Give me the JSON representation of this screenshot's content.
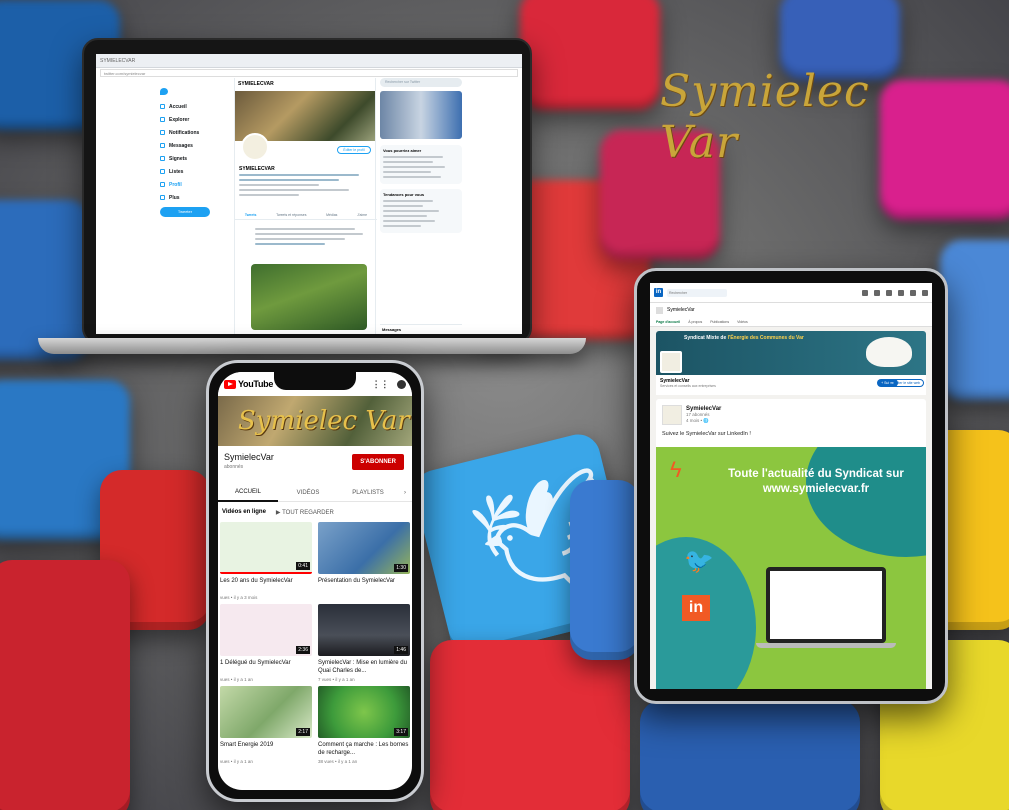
{
  "logo": {
    "text": "Symielec Var"
  },
  "laptop": {
    "browser_tab": "SYMIELECVAR",
    "address": "twitter.com/symielecvar",
    "nav": [
      "Accueil",
      "Explorer",
      "Notifications",
      "Messages",
      "Signets",
      "Listes",
      "Profil",
      "Plus"
    ],
    "tweet_button": "Tweeter",
    "profile_header": "SYMIELECVAR",
    "profile_name": "SYMIELECVAR",
    "edit_profile": "Éditer le profil",
    "tabs": [
      "Tweets",
      "Tweets et réponses",
      "Médias",
      "J'aime"
    ],
    "search_placeholder": "Rechercher sur Twitter",
    "suggest_title": "Vous pourriez aimer",
    "trends_title": "Tendances pour vous",
    "messages": "Messages"
  },
  "phone": {
    "app": "YouTube",
    "banner_text": "Symielec Var",
    "channel": "SymielecVar",
    "subscribers": "abonnés",
    "subscribe_button": "S'ABONNER",
    "tabs": [
      "ACCUEIL",
      "VIDÉOS",
      "PLAYLISTS"
    ],
    "section": "Vidéos en ligne",
    "play_all": "TOUT REGARDER",
    "videos": [
      {
        "title": "Les 20 ans du SymielecVar",
        "meta": "vues • il y a 3 mois",
        "duration": "0:41"
      },
      {
        "title": "Présentation du SymielecVar",
        "meta": "",
        "duration": "1:30"
      },
      {
        "title": "1 Délégué du SymielecVar",
        "meta": "vues • il y a 1 an",
        "duration": "2:36"
      },
      {
        "title": "SymielecVar : Mise en lumière du Quai Charles de...",
        "meta": "7 vues • il y a 1 an",
        "duration": "1:46"
      },
      {
        "title": "Smart Energie 2019",
        "meta": "vues • il y a 1 an",
        "duration": "2:17"
      },
      {
        "title": "Comment ça marche : Les bornes de recharge...",
        "meta": "38 vues • il y a 1 an",
        "duration": "3:17"
      }
    ],
    "thumb_colors": [
      "#e8f3e2",
      "#3b6fa8",
      "#f6e9ef",
      "#2a2f3a",
      "#7fa86a",
      "#3d9b3b"
    ]
  },
  "tablet": {
    "search_placeholder": "Rechercher",
    "page_name": "SymielecVar",
    "tabs": [
      "Page d'accueil",
      "À propos",
      "Publications",
      "Vidéos"
    ],
    "cover_title_pre": "Syndicat Mixte de",
    "cover_title_hl": "l'Énergie des Communes du Var",
    "company_name": "SymielecVar",
    "company_desc": "Services et conseils aux entreprises",
    "follow_button": "+ Suivre",
    "visit_button": "Visiter le site web",
    "post_author": "SymielecVar",
    "post_followers": "17 abonnés",
    "post_time": "4 mois •",
    "post_text": "Suivez le SymielecVar sur LinkedIn !",
    "image_headline": "Toute l'actualité du Syndicat sur www.symielecvar.fr",
    "image_linkedin": "in"
  },
  "colors": {
    "twitter": "#1da1f2",
    "youtube": "#ff0000",
    "linkedin": "#0a66c2",
    "lime": "#8cc63f",
    "orange": "#f15a24",
    "teal": "#1f8d8a"
  }
}
